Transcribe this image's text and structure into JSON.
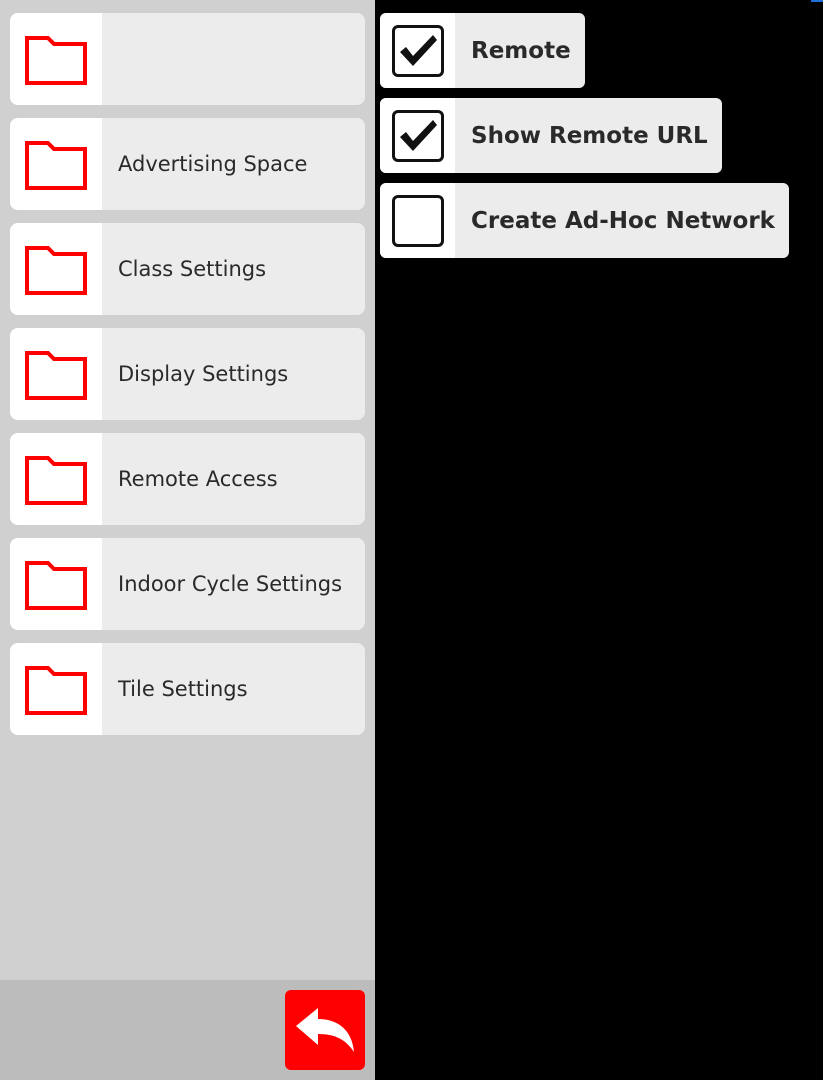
{
  "sidebar": {
    "items": [
      {
        "label": "",
        "icon": "folder-icon"
      },
      {
        "label": "Advertising Space",
        "icon": "folder-icon"
      },
      {
        "label": "Class Settings",
        "icon": "folder-icon"
      },
      {
        "label": "Display Settings",
        "icon": "folder-icon"
      },
      {
        "label": "Remote Access",
        "icon": "folder-icon"
      },
      {
        "label": "Indoor Cycle Settings",
        "icon": "folder-icon"
      },
      {
        "label": "Tile Settings",
        "icon": "folder-icon"
      }
    ],
    "back_button": {
      "icon": "back-arrow-icon"
    }
  },
  "options": [
    {
      "label": "Remote",
      "checked": true
    },
    {
      "label": "Show Remote URL",
      "checked": true
    },
    {
      "label": "Create Ad-Hoc Network",
      "checked": false
    }
  ],
  "colors": {
    "accent": "#ff0000",
    "sidebar_bg": "#d0d0d0",
    "item_bg": "#ececec",
    "content_bg": "#000000"
  }
}
